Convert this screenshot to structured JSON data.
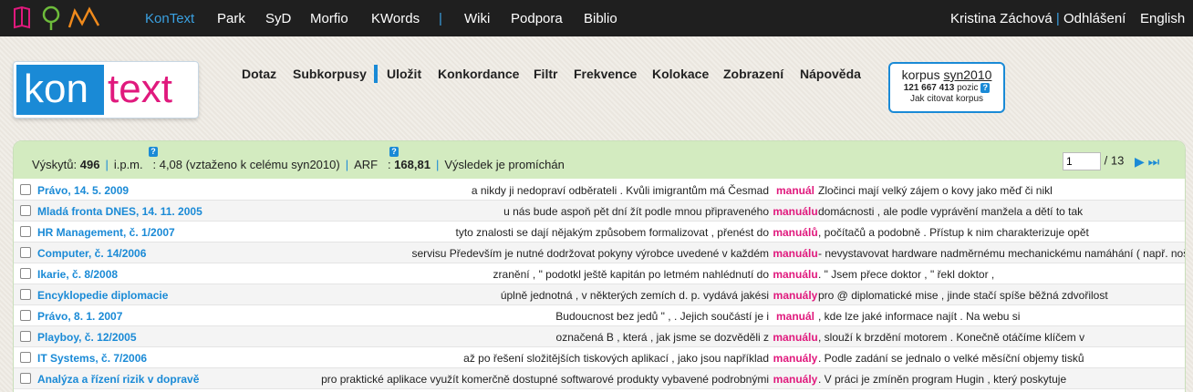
{
  "topbar": {
    "apps": [
      "KonText",
      "Park",
      "SyD",
      "Morfio",
      "KWords"
    ],
    "sep": "|",
    "links": [
      "Wiki",
      "Podpora",
      "Biblio"
    ],
    "user": "Kristina Záchová",
    "logout": "Odhlášení",
    "language": "English"
  },
  "logo": {
    "part1": "kon",
    "part2": "text"
  },
  "mainmenu": [
    "Dotaz",
    "Subkorpusy",
    "Uložit",
    "Konkordance",
    "Filtr",
    "Frekvence",
    "Kolokace",
    "Zobrazení",
    "Nápověda"
  ],
  "corpus": {
    "label": "korpus",
    "name": "syn2010",
    "size": "121 667 413",
    "size_unit": "pozic",
    "help": "?",
    "cite": "Jak citovat korpus"
  },
  "info": {
    "hits_label": "Výskytů:",
    "hits": "496",
    "ipm_label": "i.p.m.",
    "ipm_value": ": 4,08 (vztaženo k celému syn2010)",
    "arf_label": "ARF",
    "arf_value": "168,81",
    "shuffled": "Výsledek je promíchán",
    "help": "?"
  },
  "pager": {
    "current": "1",
    "total": "/ 13",
    "arrows": "▶ ⏭"
  },
  "rows": [
    {
      "ref": "Právo, 14. 5. 2009",
      "left": "a nikdy ji nedopraví odběrateli . Kvůli imigrantům má Česmad",
      "kwic": "manuál",
      "right": "Zločinci mají velký zájem o kovy jako měď či nikl"
    },
    {
      "ref": "Mladá fronta DNES, 14. 11. 2005",
      "left": "u nás bude aspoň pět dní žít podle mnou připraveného",
      "kwic": "manuálu",
      "right": "domácnosti , ale podle vyprávění manžela a dětí to tak"
    },
    {
      "ref": "HR Management, č. 1/2007",
      "left": "tyto znalosti se dají nějakým způsobem formalizovat , přenést do",
      "kwic": "manuálů",
      "right": ", počítačů a podobně . Přístup k nim charakterizuje opět"
    },
    {
      "ref": "Computer, č. 14/2006",
      "left": "servisu Především je nutné dodržovat pokyny výrobce uvedené v každém",
      "kwic": "manuálu",
      "right": "- nevystavovat hardware nadměrnému mechanickému namáhání ( např. nošení"
    },
    {
      "ref": "Ikarie, č. 8/2008",
      "left": "zranění , \" podotkl ještě kapitán po letmém nahlédnutí do",
      "kwic": "manuálu",
      "right": ". \" Jsem přece doktor , \" řekl doktor ,"
    },
    {
      "ref": "Encyklopedie diplomacie",
      "left": "úplně jednotná , v některých zemích d. p. vydává jakési",
      "kwic": "manuály",
      "right": "pro @ diplomatické mise , jinde stačí spíše běžná zdvořilost"
    },
    {
      "ref": "Právo, 8. 1. 2007",
      "left": "Budoucnost bez jedů \" , . Jejich součástí je i",
      "kwic": "manuál",
      "right": ", kde lze jaké informace najít . Na webu si"
    },
    {
      "ref": "Playboy, č. 12/2005",
      "left": "označená B , která , jak jsme se dozvěděli z",
      "kwic": "manuálu",
      "right": ", slouží k brzdění motorem . Konečně otáčíme klíčem v"
    },
    {
      "ref": "IT Systems, č. 7/2006",
      "left": "až po řešení složitějších tiskových aplikací , jako jsou například",
      "kwic": "manuály",
      "right": ". Podle zadání se jednalo o velké měsíční objemy tisků"
    },
    {
      "ref": "Analýza a řízení rizik v dopravě",
      "left": "pro praktické aplikace využít komerčně dostupné softwarové produkty vybavené podrobnými",
      "kwic": "manuály",
      "right": ". V práci je zmíněn program Hugin , který poskytuje"
    }
  ],
  "colors": {
    "blue": "#1a8ad6",
    "magenta": "#e0197d",
    "green_bar": "#d3ebc0",
    "topbar": "#1f1f1f"
  }
}
